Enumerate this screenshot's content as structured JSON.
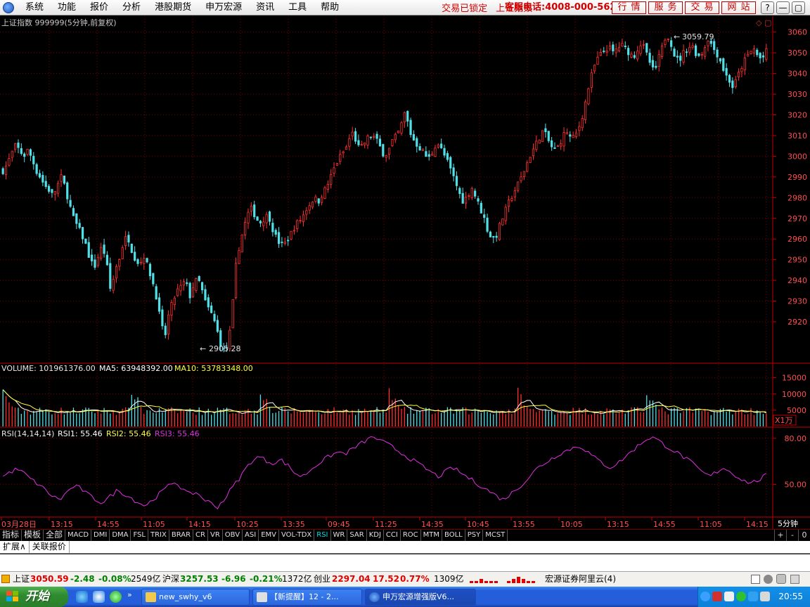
{
  "menu": {
    "items": [
      "系统",
      "功能",
      "报价",
      "分析",
      "港股期货",
      "申万宏源",
      "资讯",
      "工具",
      "帮助"
    ],
    "status": "交易已锁定",
    "index_name": "上证指数",
    "hotline": "客服电话:4008-000-562",
    "buttons": [
      "行情",
      "服务",
      "交易",
      "网站"
    ],
    "window_controls": [
      "?",
      "—",
      "▢",
      "✕"
    ]
  },
  "chart": {
    "title": "上证指数 999999(5分钟,前复权)",
    "high_label": "3059.79",
    "low_label": "2905.28",
    "volume_header": {
      "label": "VOLUME: 101961376.00",
      "ma5": "MA5: 63948392.00",
      "ma10": "MA10: 53783348.00"
    },
    "volume_unit": "X1万",
    "rsi_header": {
      "label": "RSI(14,14,14)",
      "rsi1": "RSI1: 55.46",
      "rsi2": "RSI2: 55.46",
      "rsi3": "RSI3: 55.46"
    },
    "period": "5分钟",
    "colors": {
      "up": "#ff3030",
      "down": "#50e0e8",
      "ma5": "#ffffff",
      "ma10": "#ffff40",
      "rsi": "#e030e0",
      "grid": "#800000",
      "axis": "#c00000",
      "price_text": "#ff5050"
    }
  },
  "chart_data": {
    "type": "candlestick",
    "title": "上证指数 999999(5分钟,前复权)",
    "price_axis": {
      "ticks": [
        2920,
        2930,
        2940,
        2950,
        2960,
        2970,
        2980,
        2990,
        3000,
        3010,
        3020,
        3030,
        3040,
        3050,
        3060
      ],
      "ylim": [
        2902,
        3065
      ]
    },
    "price_path": [
      2993,
      2996,
      3001,
      3005,
      3003,
      3000,
      3003,
      2999,
      2993,
      2990,
      2986,
      2984,
      2981,
      2985,
      2990,
      2985,
      2977,
      2970,
      2966,
      2962,
      2957,
      2950,
      2946,
      2952,
      2957,
      2948,
      2934,
      2945,
      2950,
      2958,
      2962,
      2955,
      2950,
      2948,
      2952,
      2946,
      2940,
      2932,
      2920,
      2912,
      2924,
      2930,
      2935,
      2937,
      2940,
      2932,
      2938,
      2941,
      2935,
      2928,
      2925,
      2920,
      2913,
      2905.28,
      2908,
      2918,
      2945,
      2957,
      2965,
      2972,
      2975,
      2970,
      2968,
      2970,
      2972,
      2965,
      2960,
      2957,
      2958,
      2961,
      2965,
      2968,
      2970,
      2974,
      2977,
      2980,
      2978,
      2982,
      2985,
      2990,
      2995,
      2999,
      3002,
      3005,
      3012,
      3008,
      3003,
      3006,
      3009,
      3010,
      3008,
      3004,
      3000,
      3003,
      3008,
      3010,
      3015,
      3022,
      3012,
      3008,
      3005,
      3003,
      3000,
      2999,
      3005,
      3006,
      3002,
      2998,
      2993,
      2988,
      2982,
      2978,
      2981,
      2985,
      2980,
      2975,
      2970,
      2963,
      2960,
      2962,
      2968,
      2973,
      2978,
      2982,
      2986,
      2990,
      2995,
      3000,
      3004,
      3008,
      3012,
      3010,
      3005,
      3003,
      3005,
      3010,
      3012,
      3008,
      3010,
      3015,
      3022,
      3032,
      3040,
      3046,
      3049,
      3051,
      3053,
      3050,
      3052,
      3054,
      3052,
      3050,
      3048,
      3052,
      3055,
      3050,
      3045,
      3040,
      3047,
      3053,
      3059.79,
      3055,
      3048,
      3046,
      3050,
      3052,
      3054,
      3050,
      3048,
      3052,
      3057,
      3053,
      3050,
      3046,
      3040,
      3037,
      3033,
      3038,
      3043,
      3047,
      3050,
      3052,
      3048,
      3047,
      3050.59
    ],
    "volume_axis": {
      "ticks": [
        5000,
        10000,
        15000
      ],
      "unit": "X1万"
    },
    "rsi_axis": {
      "ticks": [
        50.0,
        80.0
      ],
      "ylim": [
        30,
        85
      ]
    },
    "rsi_path": [
      55,
      58,
      60,
      57,
      53,
      50,
      46,
      42,
      40,
      45,
      49,
      47,
      43,
      40,
      38,
      42,
      46,
      44,
      41,
      38,
      36,
      40,
      44,
      48,
      52,
      48,
      43,
      45,
      41,
      38,
      35,
      40,
      47,
      53,
      60,
      66,
      68,
      65,
      64,
      66,
      62,
      57,
      55,
      59,
      63,
      66,
      69,
      71,
      70,
      73,
      76,
      79,
      81,
      78,
      76,
      73,
      70,
      67,
      64,
      61,
      58,
      55,
      58,
      61,
      58,
      55,
      52,
      49,
      46,
      43,
      40,
      43,
      47,
      51,
      56,
      61,
      64,
      67,
      70,
      72,
      74,
      75,
      71,
      67,
      64,
      61,
      63,
      67,
      71,
      75,
      79,
      81,
      78,
      75,
      72,
      69,
      66,
      62,
      58,
      55,
      58,
      61,
      58,
      55,
      52,
      51,
      53,
      56
    ],
    "x_labels": [
      "03月28日",
      "13:15",
      "14:55",
      "11:05",
      "14:15",
      "10:25",
      "13:35",
      "09:45",
      "11:25",
      "14:35",
      "10:45",
      "13:55",
      "10:05",
      "13:15",
      "14:55",
      "11:05",
      "14:15"
    ],
    "series": [
      {
        "name": "RSI1",
        "value": 55.46
      },
      {
        "name": "VOLUME",
        "value": 101961376.0
      },
      {
        "name": "MA5",
        "value": 63948392.0
      },
      {
        "name": "MA10",
        "value": 53783348.0
      }
    ]
  },
  "indicator_tabs": [
    "指标",
    "模板",
    "全部",
    "MACD",
    "DMI",
    "DMA",
    "FSL",
    "TRIX",
    "BRAR",
    "CR",
    "VR",
    "OBV",
    "ASI",
    "EMV",
    "VOL-TDX",
    "RSI",
    "WR",
    "SAR",
    "KDJ",
    "CCI",
    "ROC",
    "MTM",
    "BOLL",
    "PSY",
    "MCST"
  ],
  "tab_controls": [
    "+",
    "-",
    "0"
  ],
  "ext_tabs": [
    "扩展∧",
    "关联报价"
  ],
  "status": {
    "sh_label": "上证",
    "sh_value": "3050.59",
    "sh_change": "-2.48",
    "sh_pct": "-0.08%",
    "sh_amount": "2549亿",
    "hs_label": "沪深",
    "hs_value": "3257.53",
    "hs_change": "-6.96",
    "hs_pct": "-0.21%",
    "hs_amount": "1372亿",
    "cy_label": "创业",
    "cy_value": "2297.04",
    "cy_change": "17.52",
    "cy_pct": "0.77%",
    "cy_amount": "1309亿",
    "broker": "宏源证券阿里云(4)"
  },
  "taskbar": {
    "start": "开始",
    "tasks": [
      "new_swhy_v6",
      "【新提醒】12 - 2...",
      "申万宏源增强版V6..."
    ],
    "clock": "20:55"
  }
}
